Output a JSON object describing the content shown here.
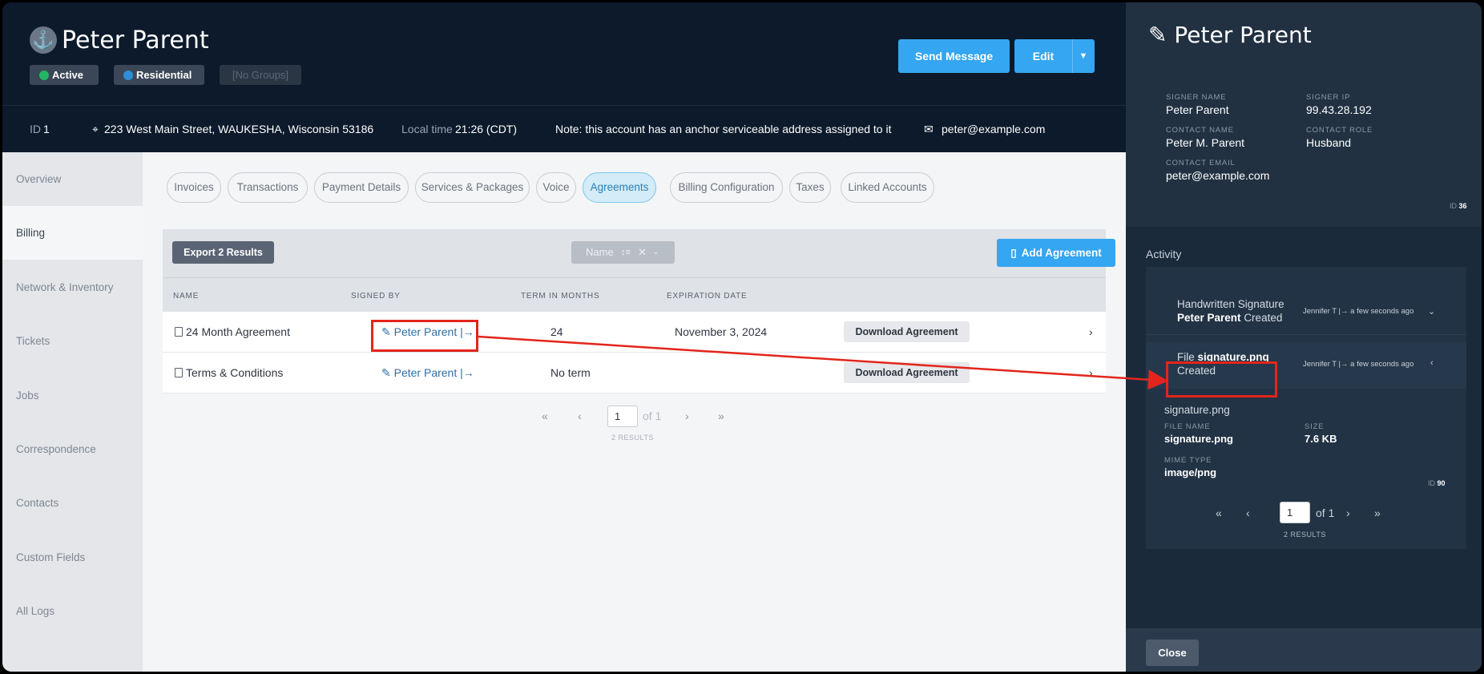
{
  "header": {
    "name": "Peter Parent",
    "badges": {
      "active": "Active",
      "residential": "Residential",
      "groups": "[No Groups]"
    },
    "send_message": "Send Message",
    "edit": "Edit"
  },
  "infobar": {
    "id_label": "ID",
    "id_value": "1",
    "address": "223 West Main Street, WAUKESHA, Wisconsin 53186",
    "local_time_label": "Local time",
    "local_time_value": "21:26 (CDT)",
    "note": "Note: this account has an anchor serviceable address assigned to it",
    "email": "peter@example.com"
  },
  "nav": [
    "Overview",
    "Billing",
    "Network & Inventory",
    "Tickets",
    "Jobs",
    "Correspondence",
    "Contacts",
    "Custom Fields",
    "All Logs"
  ],
  "tabs": [
    "Invoices",
    "Transactions",
    "Payment Details",
    "Services & Packages",
    "Voice",
    "Agreements",
    "Billing Configuration",
    "Taxes",
    "Linked Accounts"
  ],
  "toolbar": {
    "export": "Export 2 Results",
    "sort": "Name",
    "add": "Add Agreement"
  },
  "table": {
    "headers": [
      "NAME",
      "SIGNED BY",
      "TERM IN MONTHS",
      "EXPIRATION DATE"
    ],
    "rows": [
      {
        "name": "24 Month Agreement",
        "signed_by": "Peter Parent",
        "term": "24",
        "expiration": "November 3, 2024",
        "action": "Download Agreement"
      },
      {
        "name": "Terms & Conditions",
        "signed_by": "Peter Parent",
        "term": "No term",
        "expiration": "",
        "action": "Download Agreement"
      }
    ]
  },
  "pager": {
    "page": "1",
    "of": "of 1",
    "count": "2 RESULTS",
    "first": "«",
    "prev": "‹",
    "next": "›",
    "last": "»"
  },
  "panel": {
    "title": "Peter Parent",
    "fields": {
      "signer_name_label": "SIGNER NAME",
      "signer_name": "Peter Parent",
      "signer_ip_label": "SIGNER IP",
      "signer_ip": "99.43.28.192",
      "contact_name_label": "CONTACT NAME",
      "contact_name": "Peter M. Parent",
      "contact_role_label": "CONTACT ROLE",
      "contact_role": "Husband",
      "contact_email_label": "CONTACT EMAIL",
      "contact_email": "peter@example.com"
    },
    "id_label": "ID",
    "id_value": "36",
    "activity_label": "Activity",
    "activity": [
      {
        "line1": "Handwritten Signature",
        "bold": "Peter Parent",
        "line2": "Created",
        "user": "Jennifer T",
        "time": "a few seconds ago"
      },
      {
        "prefix": "File",
        "bold": "signature.png",
        "line2": "Created",
        "user": "Jennifer T",
        "time": "a few seconds ago"
      }
    ],
    "file": {
      "heading": "signature.png",
      "file_name_label": "FILE NAME",
      "file_name": "signature.png",
      "size_label": "SIZE",
      "size": "7.6 KB",
      "mime_label": "MIME TYPE",
      "mime": "image/png",
      "id_label": "ID",
      "id_value": "90"
    },
    "pager": {
      "page": "1",
      "of": "of 1",
      "count": "2 RESULTS",
      "first": "«",
      "prev": "‹",
      "next": "›",
      "last": "»"
    },
    "close": "Close"
  },
  "colors": {
    "accent": "#35a6f1",
    "highlight": "#e3251b",
    "dark": "#0c1a2b"
  }
}
